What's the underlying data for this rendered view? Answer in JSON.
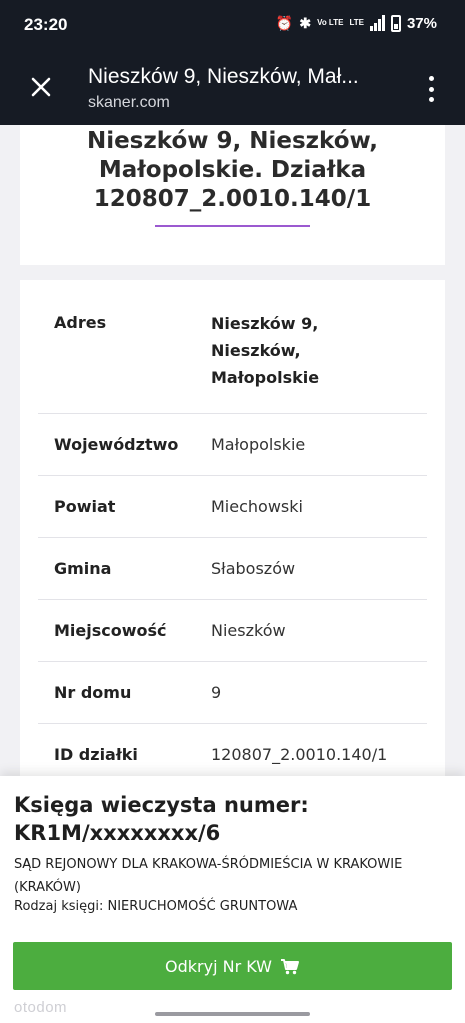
{
  "status_bar": {
    "time": "23:20",
    "network": "Vo LTE",
    "lte": "LTE",
    "battery": "37%"
  },
  "browser": {
    "title": "Nieszków 9, Nieszków, Mał...",
    "url": "skaner.com"
  },
  "page": {
    "title_line1": "Nieszków 9, Nieszków,",
    "title_line2": "Małopolskie. Działka",
    "title_line3": "120807_2.0010.140/1"
  },
  "details": [
    {
      "label": "Adres",
      "value_lines": [
        "Nieszków 9,",
        "Nieszków,",
        "Małopolskie"
      ]
    },
    {
      "label": "Województwo",
      "value": "Małopolskie"
    },
    {
      "label": "Powiat",
      "value": "Miechowski"
    },
    {
      "label": "Gmina",
      "value": "Słaboszów"
    },
    {
      "label": "Miejscowość",
      "value": "Nieszków"
    },
    {
      "label": "Nr domu",
      "value": "9"
    },
    {
      "label": "ID działki",
      "value": "120807_2.0010.140/1"
    }
  ],
  "land_register": {
    "title_line1": "Księga wieczysta numer:",
    "title_line2": "KR1M/xxxxxxxx/6",
    "court_line1": "SĄD REJONOWY DLA KRAKOWA-ŚRÓDMIEŚCIA W KRAKOWIE",
    "court_line2": "(KRAKÓW)",
    "book_type": "Rodzaj księgi: NIERUCHOMOŚĆ GRUNTOWA",
    "reveal_button": "Odkryj Nr KW"
  },
  "footer": {
    "logo": "otodom"
  },
  "colors": {
    "browser_bar": "#161b24",
    "accent_underline": "#9b59d0",
    "button_green": "#4cad3f"
  }
}
